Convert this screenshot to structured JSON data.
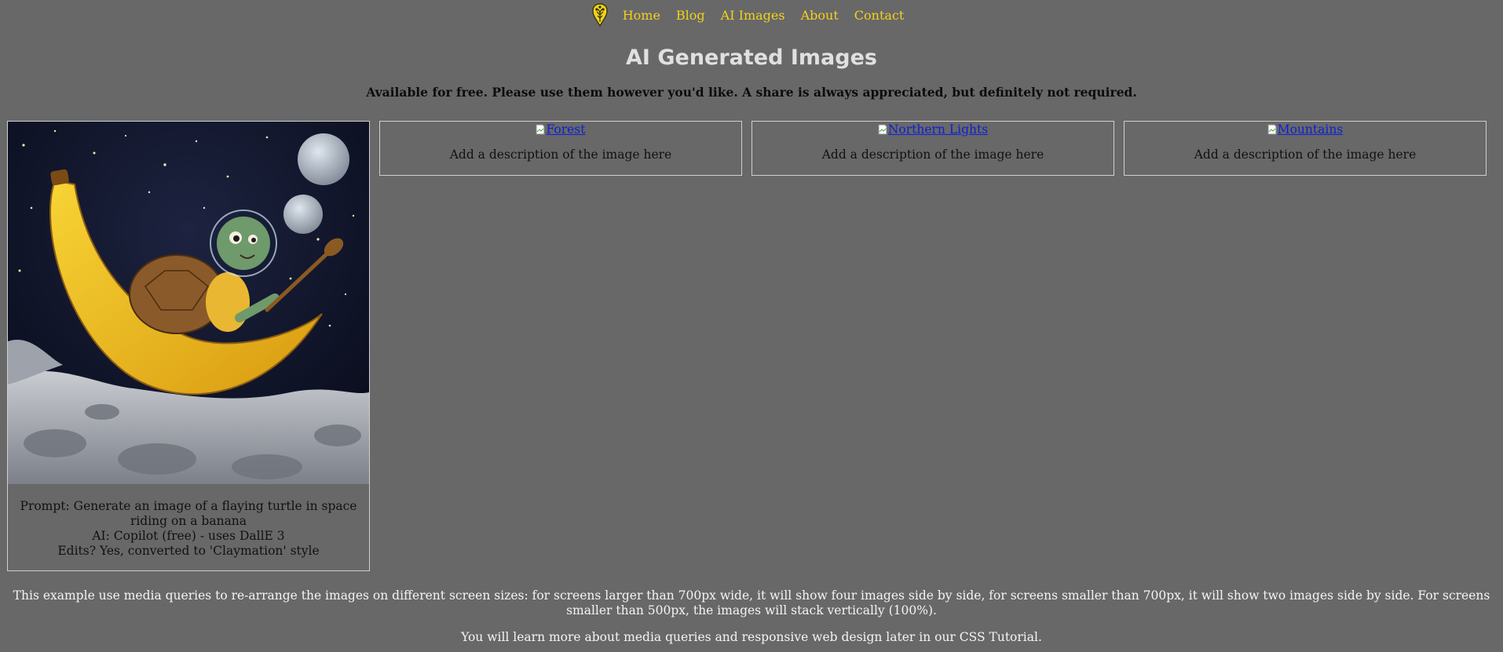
{
  "nav": {
    "logo_icon": "tree-in-shield-icon",
    "links": [
      "Home",
      "Blog",
      "AI Images",
      "About",
      "Contact"
    ],
    "link_color": "#f2d21c"
  },
  "page": {
    "title": "AI Generated Images",
    "intro": "Available for free. Please use them however you'd like. A share is always appreciated, but definitely not required.",
    "background": "#686868"
  },
  "gallery": {
    "featured": {
      "image_icon": "turtle-riding-banana-in-space-image",
      "caption_lines": [
        "Prompt: Generate an image of a flaying turtle in space riding on a banana",
        "AI: Copilot (free) - uses DallE 3",
        "Edits? Yes, converted to 'Claymation' style"
      ]
    },
    "cards": [
      {
        "alt": "Forest",
        "description": "Add a description of the image here"
      },
      {
        "alt": "Northern Lights",
        "description": "Add a description of the image here"
      },
      {
        "alt": "Mountains",
        "description": "Add a description of the image here"
      }
    ]
  },
  "footer": {
    "paragraph1": "This example use media queries to re-arrange the images on different screen sizes: for screens larger than 700px wide, it will show four images side by side, for screens smaller than 700px, it will show two images side by side. For screens smaller than 500px, the images will stack vertically (100%).",
    "paragraph2": "You will learn more about media queries and responsive web design later in our CSS Tutorial."
  }
}
